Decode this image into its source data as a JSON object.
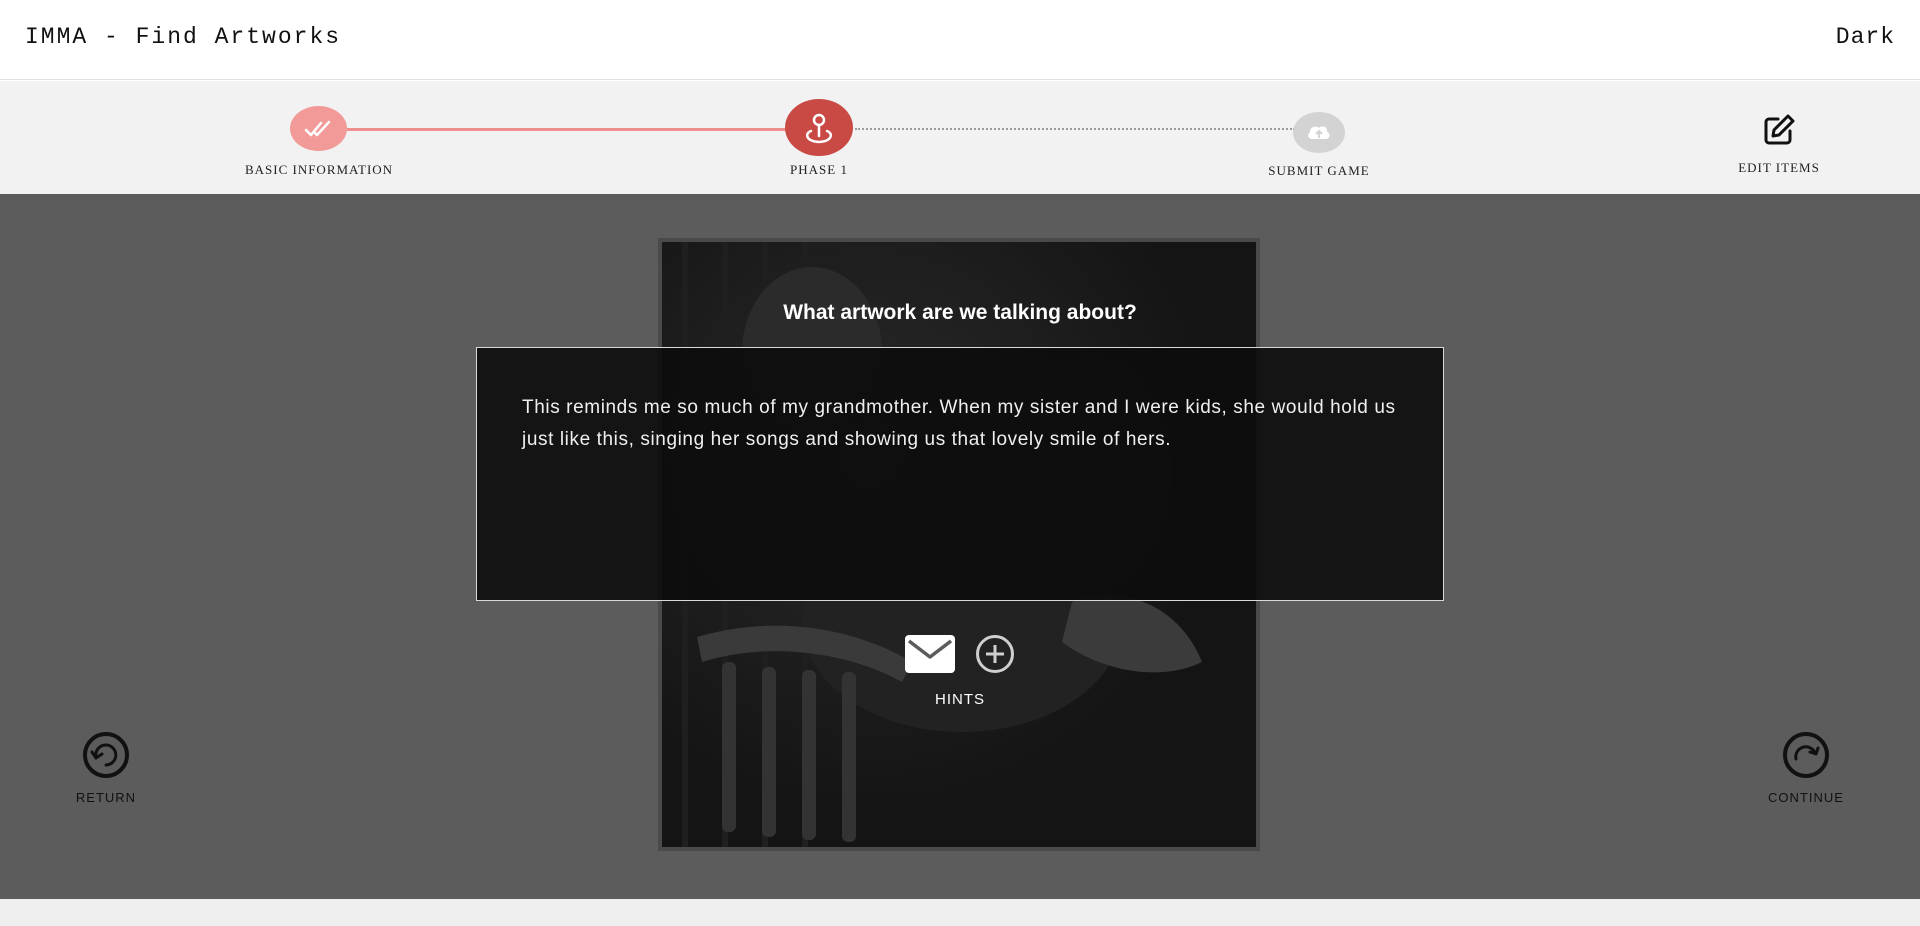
{
  "header": {
    "title": "IMMA - Find Artworks",
    "theme_toggle": "Dark"
  },
  "stepper": {
    "steps": [
      {
        "label": "BASIC INFORMATION",
        "icon": "double-check-icon",
        "state": "completed"
      },
      {
        "label": "PHASE 1",
        "icon": "map-pin-icon",
        "state": "current"
      },
      {
        "label": "SUBMIT GAME",
        "icon": "cloud-upload-icon",
        "state": "pending"
      }
    ],
    "edit_items": {
      "label": "EDIT ITEMS",
      "icon": "edit-icon"
    }
  },
  "main": {
    "question": "What artwork are we talking about?",
    "description": "This reminds me so much of my grandmother. When my sister and I were kids, she would hold us just like this, singing her songs and showing us that lovely smile of hers.",
    "hints_label": "HINTS",
    "return_label": "RETURN",
    "continue_label": "CONTINUE"
  },
  "colors": {
    "completed": "#f29a97",
    "current": "#c94a45",
    "pending": "#d3d3d3",
    "main_bg": "#5c5c5c"
  }
}
